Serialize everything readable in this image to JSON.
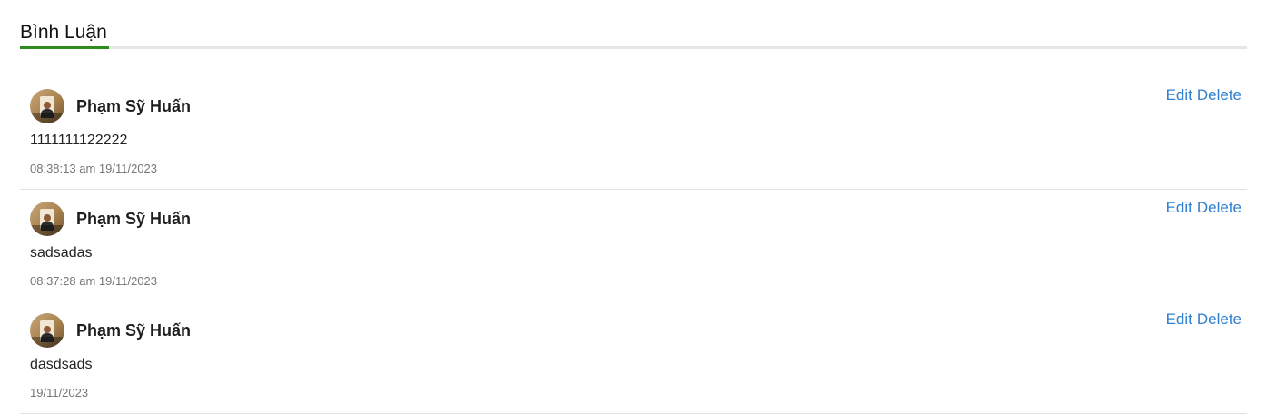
{
  "section": {
    "title": "Bình Luận"
  },
  "comments": [
    {
      "author": "Phạm Sỹ Huấn",
      "text": "1111111122222",
      "time": "08:38:13 am 19/11/2023",
      "edit_label": "Edit",
      "delete_label": "Delete"
    },
    {
      "author": "Phạm Sỹ Huấn",
      "text": "sadsadas",
      "time": "08:37:28 am 19/11/2023",
      "edit_label": "Edit",
      "delete_label": "Delete"
    },
    {
      "author": "Phạm Sỹ Huấn",
      "text": "dasdsads",
      "time": "19/11/2023",
      "edit_label": "Edit",
      "delete_label": "Delete"
    }
  ],
  "colors": {
    "accent_underline": "#2e8b1e",
    "link": "#2f80d1",
    "timestamp": "#777777"
  }
}
